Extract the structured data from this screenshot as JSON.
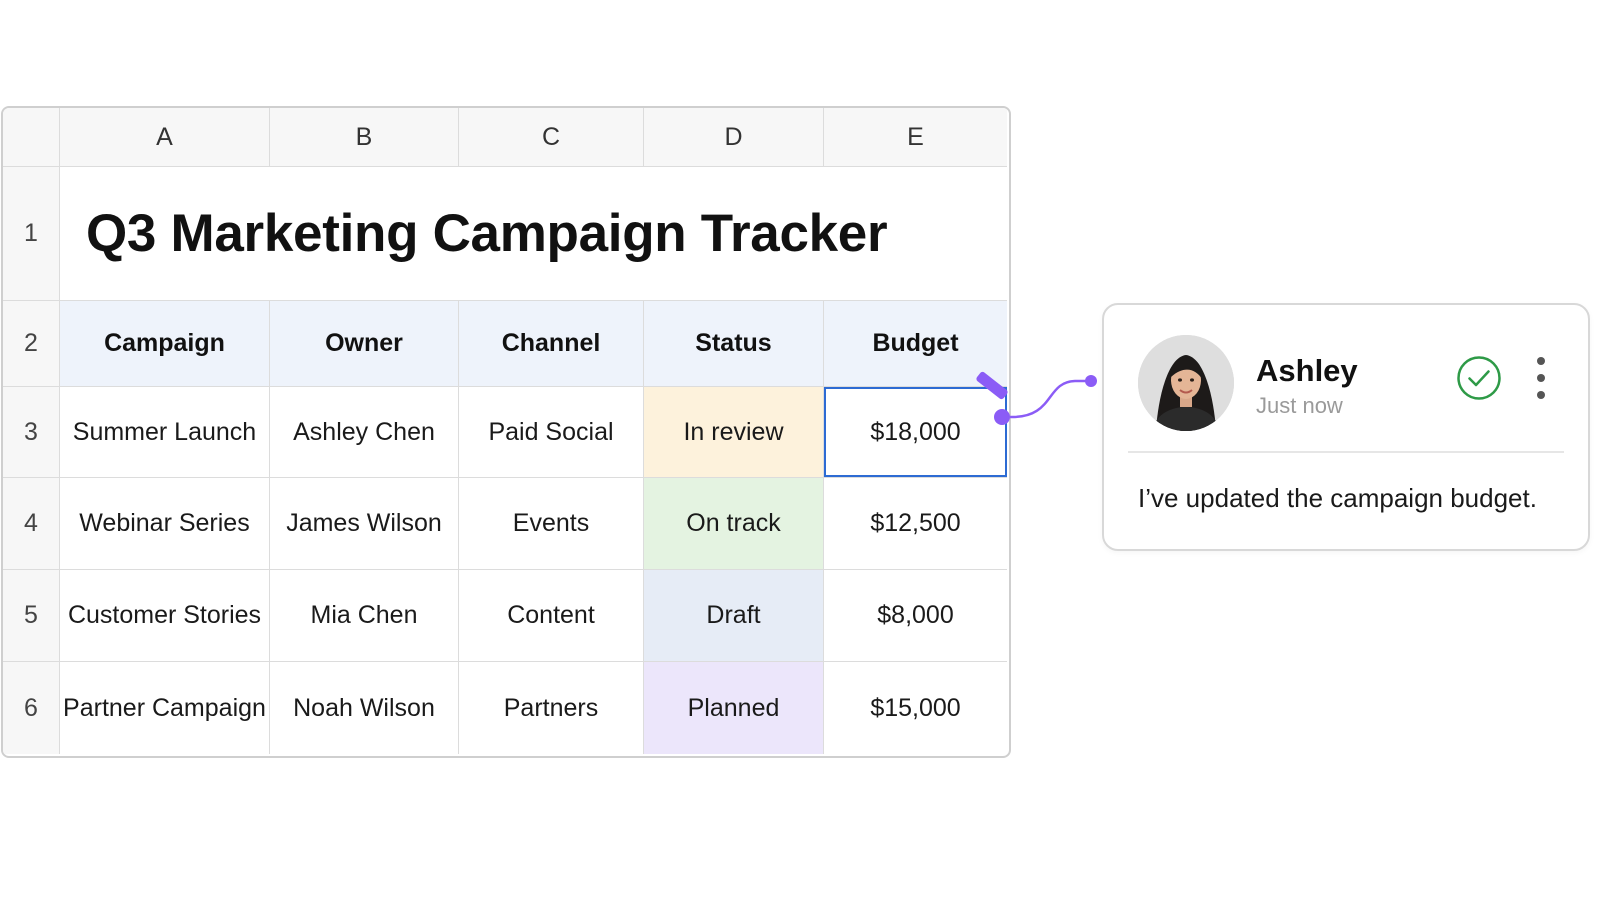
{
  "sheet": {
    "columns": [
      "A",
      "B",
      "C",
      "D",
      "E"
    ],
    "rows": [
      "1",
      "2",
      "3",
      "4",
      "5",
      "6"
    ],
    "title": "Q3 Marketing Campaign Tracker",
    "headers": [
      "Campaign",
      "Owner",
      "Channel",
      "Status",
      "Budget"
    ],
    "data": [
      {
        "campaign": "Summer Launch",
        "owner": "Ashley Chen",
        "channel": "Paid Social",
        "status": "In review",
        "budget": "$18,000"
      },
      {
        "campaign": "Webinar Series",
        "owner": "James Wilson",
        "channel": "Events",
        "status": "On track",
        "budget": "$12,500"
      },
      {
        "campaign": "Customer Stories",
        "owner": "Mia Chen",
        "channel": "Content",
        "status": "Draft",
        "budget": "$8,000"
      },
      {
        "campaign": "Partner Campaign",
        "owner": "Noah Wilson",
        "channel": "Partners",
        "status": "Planned",
        "budget": "$15,000"
      }
    ],
    "selected_cell": "E3",
    "status_colors": {
      "In review": "#fdf2dc",
      "On track": "#e4f3e1",
      "Draft": "#e6ecf6",
      "Planned": "#ece6fb"
    },
    "selection_color": "#2d6bd3",
    "header_bg": "#eef3fb"
  },
  "comment": {
    "author": "Ashley",
    "time": "Just now",
    "text": "I’ve updated the campaign budget.",
    "resolve_icon": "check-circle-icon",
    "menu_icon": "more-vertical-icon",
    "accent_color": "#8b5cf6",
    "check_color": "#2e9a47"
  }
}
